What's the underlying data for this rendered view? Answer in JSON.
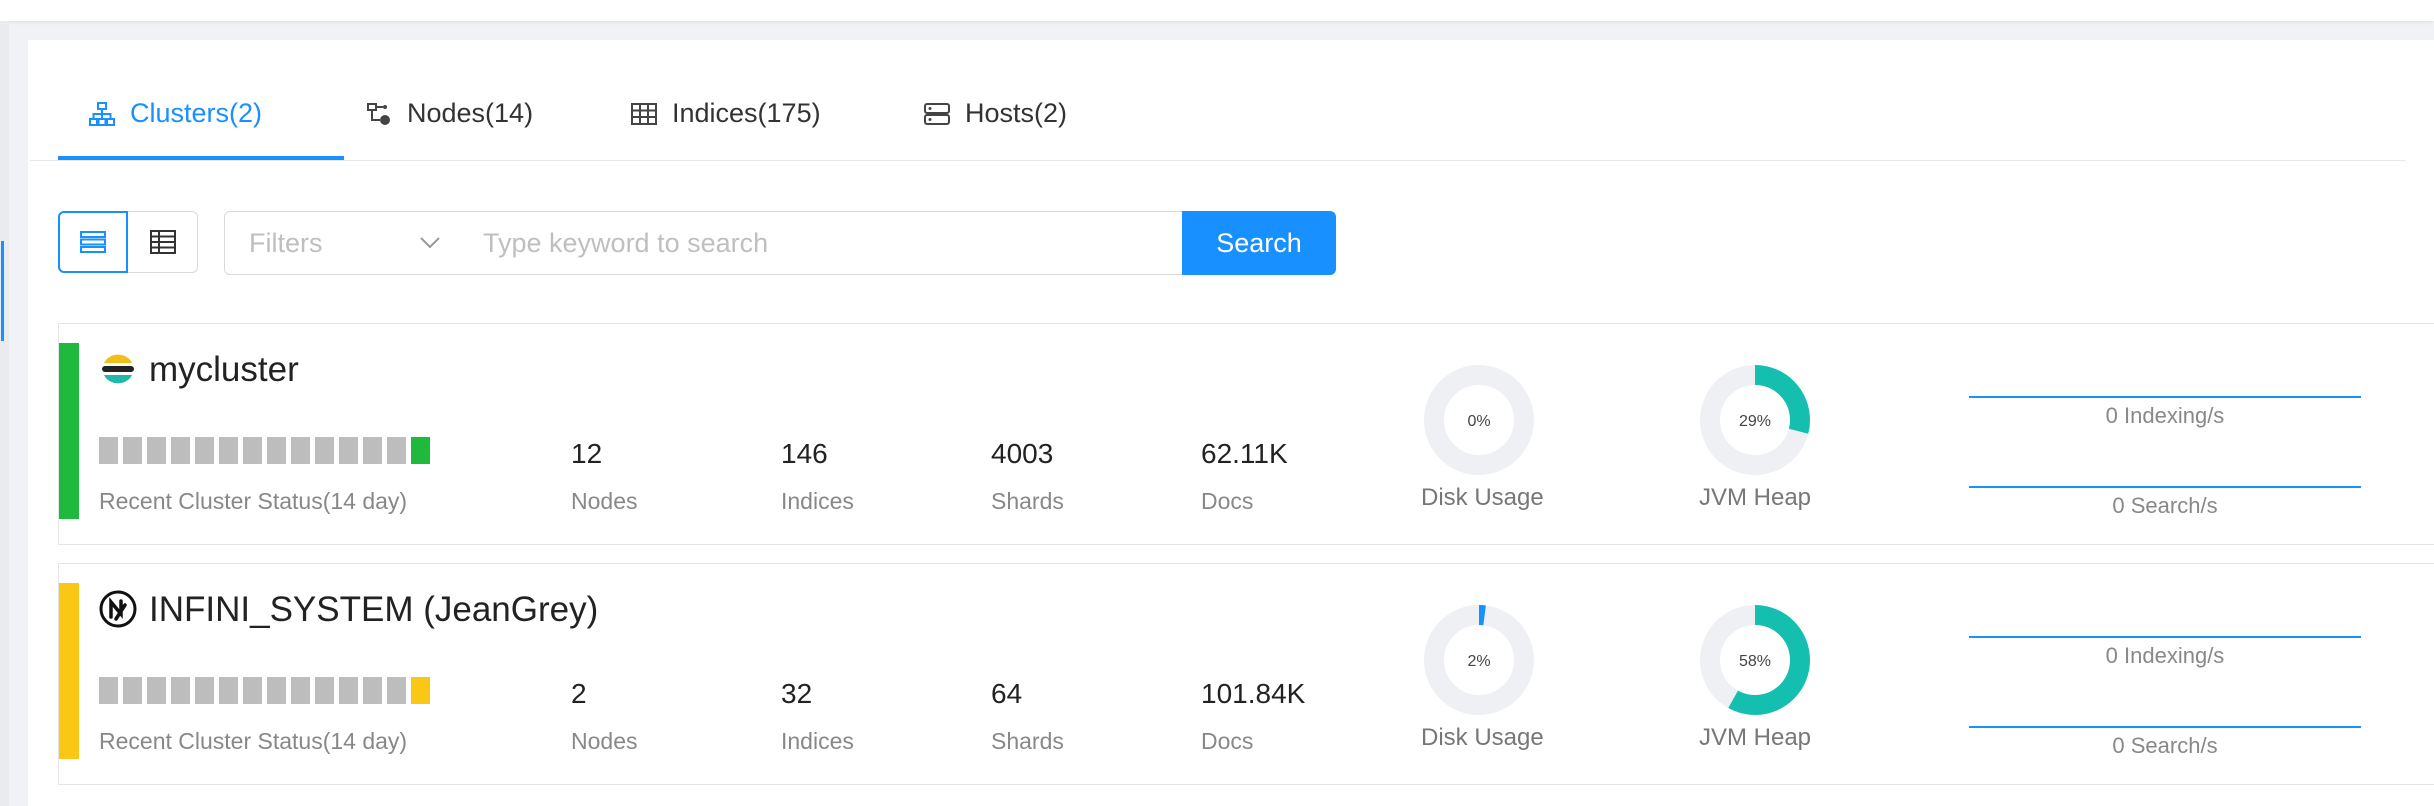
{
  "tabs": [
    {
      "label": "Clusters(2)",
      "icon": "cluster-icon",
      "active": true
    },
    {
      "label": "Nodes(14)",
      "icon": "node-icon",
      "active": false
    },
    {
      "label": "Indices(175)",
      "icon": "table-icon",
      "active": false
    },
    {
      "label": "Hosts(2)",
      "icon": "server-icon",
      "active": false
    }
  ],
  "toolbar": {
    "filters_placeholder": "Filters",
    "search_placeholder": "Type keyword to search",
    "search_label": "Search"
  },
  "colors": {
    "accent": "#1890ff",
    "green": "#1fb93d",
    "yellow": "#fac814",
    "gray": "#bdbdbd",
    "teal": "#14bfb0",
    "ring": "#eef0f3"
  },
  "clusters": [
    {
      "name": "mycluster",
      "logo": "elasticsearch-logo",
      "health_color": "#1fb93d",
      "status_history": [
        "gray",
        "gray",
        "gray",
        "gray",
        "gray",
        "gray",
        "gray",
        "gray",
        "gray",
        "gray",
        "gray",
        "gray",
        "gray",
        "green"
      ],
      "status_caption": "Recent Cluster Status(14 day)",
      "nodes": "12",
      "nodes_label": "Nodes",
      "indices": "146",
      "indices_label": "Indices",
      "shards": "4003",
      "shards_label": "Shards",
      "docs": "62.11K",
      "docs_label": "Docs",
      "disk_pct": 0,
      "disk_text": "0%",
      "disk_label": "Disk Usage",
      "jvm_pct": 29,
      "jvm_text": "29%",
      "jvm_label": "JVM Heap",
      "indexing": "0 Indexing/s",
      "search": "0 Search/s"
    },
    {
      "name": "INFINI_SYSTEM (JeanGrey)",
      "logo": "infini-logo",
      "health_color": "#fac814",
      "status_history": [
        "gray",
        "gray",
        "gray",
        "gray",
        "gray",
        "gray",
        "gray",
        "gray",
        "gray",
        "gray",
        "gray",
        "gray",
        "gray",
        "yellow"
      ],
      "status_caption": "Recent Cluster Status(14 day)",
      "nodes": "2",
      "nodes_label": "Nodes",
      "indices": "32",
      "indices_label": "Indices",
      "shards": "64",
      "shards_label": "Shards",
      "docs": "101.84K",
      "docs_label": "Docs",
      "disk_pct": 2,
      "disk_text": "2%",
      "disk_label": "Disk Usage",
      "jvm_pct": 58,
      "jvm_text": "58%",
      "jvm_label": "JVM Heap",
      "indexing": "0 Indexing/s",
      "search": "0 Search/s"
    }
  ]
}
